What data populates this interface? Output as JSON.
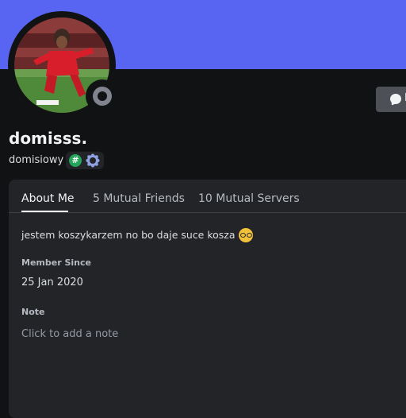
{
  "profile": {
    "display_name": "domisss.",
    "username": "domisiowy",
    "status": "offline",
    "bio": "jestem koszykarzem no bo daje suce kosza",
    "bio_emoji": "nerd-face-emoji",
    "badges": [
      "hashtag-badge-icon",
      "gear-badge-icon"
    ]
  },
  "actions": {
    "message_label": "M"
  },
  "tabs": {
    "about": "About Me",
    "friends": "5 Mutual Friends",
    "servers": "10 Mutual Servers"
  },
  "about": {
    "member_since_title": "Member Since",
    "member_since_value": "25 Jan 2020",
    "note_title": "Note",
    "note_placeholder": "Click to add a note"
  },
  "colors": {
    "banner": "#5865f2",
    "background": "#111214",
    "card": "#232428",
    "status_offline": "#80848e"
  }
}
